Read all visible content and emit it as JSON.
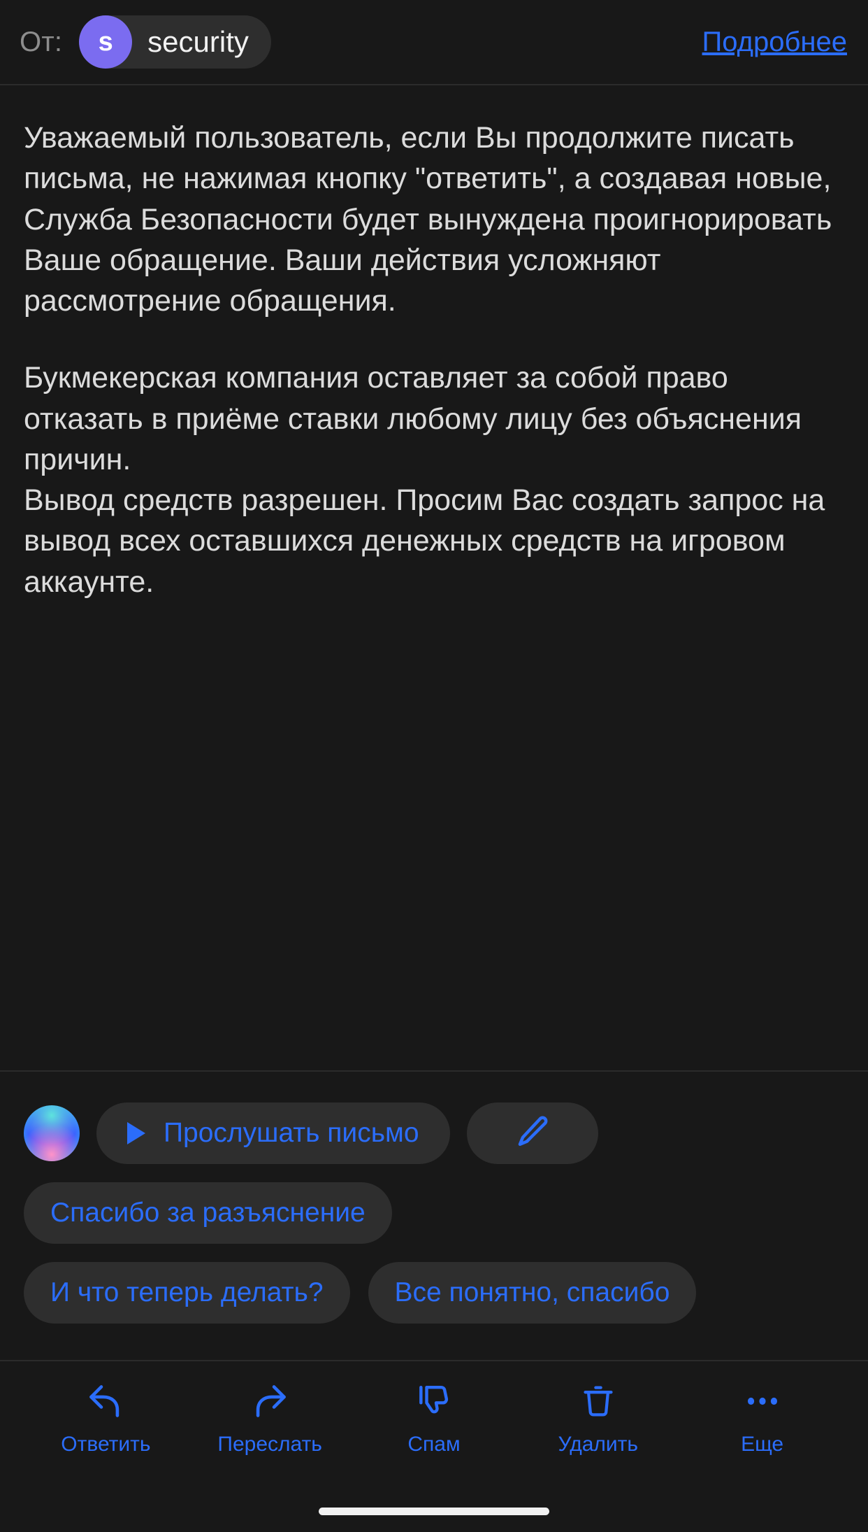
{
  "header": {
    "from_label": "От:",
    "avatar_initial": "s",
    "avatar_color": "#7b6cf0",
    "sender_name": "security",
    "details_label": "Подробнее"
  },
  "message": {
    "paragraphs": [
      "Уважаемый пользователь, если Вы продолжите писать письма, не нажимая кнопку \"ответить\", а создавая новые, Служба Безопасности будет вынуждена проигнорировать Ваше обращение. Ваши действия усложняют рассмотрение обращения.",
      "Букмекерская компания оставляет за собой право отказать в приёме ставки любому лицу без объяснения причин.\nВывод средств разрешен. Просим Вас создать запрос на вывод всех оставшихся денежных средств на игровом аккаунте."
    ]
  },
  "assistant": {
    "orb_icon": "assistant-orb-icon",
    "listen_button": {
      "label": "Прослушать письмо",
      "icon": "play-icon"
    },
    "compose_button": {
      "icon": "pencil-icon"
    },
    "quick_replies": [
      "Спасибо за разъяснение",
      "И что теперь делать?",
      "Все понятно, спасибо"
    ]
  },
  "toolbar": {
    "accent_color": "#2b6dfa",
    "items": [
      {
        "label": "Ответить",
        "icon": "reply-icon"
      },
      {
        "label": "Переслать",
        "icon": "forward-icon"
      },
      {
        "label": "Спам",
        "icon": "thumbs-down-icon"
      },
      {
        "label": "Удалить",
        "icon": "trash-icon"
      },
      {
        "label": "Еще",
        "icon": "ellipsis-icon"
      }
    ]
  }
}
